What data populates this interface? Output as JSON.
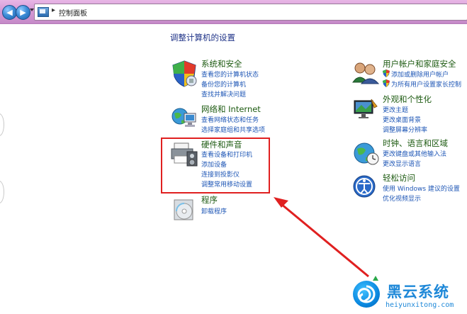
{
  "address_bar": {
    "breadcrumb": "控制面板"
  },
  "page_title": "调整计算机的设置",
  "categories": {
    "system_security": {
      "title": "系统和安全",
      "links": [
        "查看您的计算机状态",
        "备份您的计算机",
        "查找并解决问题"
      ]
    },
    "network": {
      "title": "网络和 Internet",
      "links": [
        "查看网络状态和任务",
        "选择家庭组和共享选项"
      ]
    },
    "hardware_sound": {
      "title": "硬件和声音",
      "links": [
        "查看设备和打印机",
        "添加设备",
        "连接到投影仪",
        "调整常用移动设置"
      ]
    },
    "programs": {
      "title": "程序",
      "links": [
        "卸载程序"
      ]
    },
    "user_accounts": {
      "title": "用户帐户和家庭安全",
      "links": [
        "添加或删除用户帐户",
        "为所有用户设置家长控制"
      ]
    },
    "appearance": {
      "title": "外观和个性化",
      "links": [
        "更改主题",
        "更改桌面背景",
        "调整屏幕分辨率"
      ]
    },
    "clock_region": {
      "title": "时钟、语言和区域",
      "links": [
        "更改键盘或其他输入法",
        "更改显示语言"
      ]
    },
    "ease_of_access": {
      "title": "轻松访问",
      "links": [
        "使用 Windows 建议的设置",
        "优化视频显示"
      ]
    }
  },
  "watermark": {
    "name": "黑云系统",
    "url": "heiyunxitong.com"
  },
  "colors": {
    "title_bar": "#d59ad6",
    "category_title": "#1e5b12",
    "link": "#1f57b6",
    "highlight_box": "#e02020",
    "arrow": "#e02020",
    "watermark": "#1e88d8"
  }
}
